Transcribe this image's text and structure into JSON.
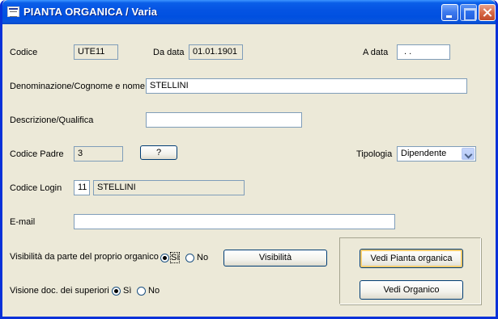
{
  "window": {
    "title": "PIANTA ORGANICA / Varia"
  },
  "form": {
    "codice": {
      "label": "Codice",
      "value": "UTE11"
    },
    "da_data": {
      "label": "Da data",
      "value": "01.01.1901"
    },
    "a_data": {
      "label": "A data",
      "value": ". ."
    },
    "denominazione": {
      "label": "Denominazione/Cognome e nome",
      "value": "STELLINI"
    },
    "descrizione": {
      "label": "Descrizione/Qualifica",
      "value": ""
    },
    "codice_padre": {
      "label": "Codice Padre",
      "value": "3",
      "button_label": "?"
    },
    "tipologia": {
      "label": "Tipologia",
      "value": "Dipendente"
    },
    "codice_login": {
      "label": "Codice Login",
      "id_value": "11",
      "name_value": "STELLINI"
    },
    "email": {
      "label": "E-mail",
      "value": ""
    },
    "visibilita": {
      "label": "Visibilità da parte del proprio organico",
      "options": [
        "Sì",
        "No"
      ],
      "selected": "Sì",
      "button_label": "Visibilità"
    },
    "visione": {
      "label": "Visione doc. dei superiori",
      "options": [
        "Sì",
        "No"
      ],
      "selected": "Sì"
    }
  },
  "actions": {
    "vedi_pianta": "Vedi Pianta organica",
    "vedi_organico": "Vedi Organico"
  }
}
